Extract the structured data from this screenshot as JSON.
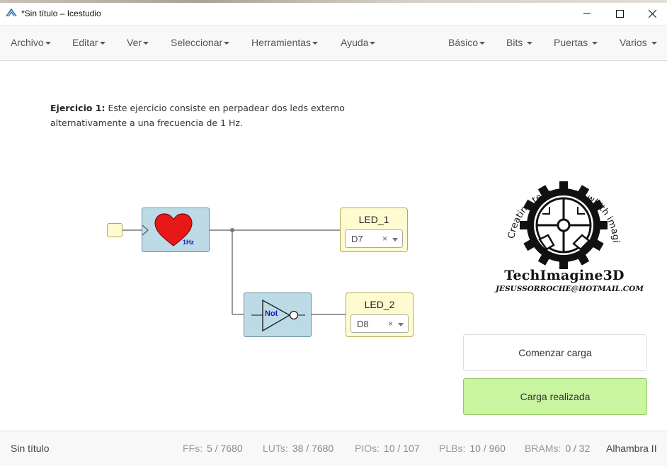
{
  "window": {
    "title": "*Sin título – Icestudio",
    "controls": {
      "minimize": "minimize-icon",
      "maximize": "maximize-icon",
      "close": "close-icon"
    }
  },
  "menubar": {
    "left": [
      {
        "label": "Archivo"
      },
      {
        "label": "Editar"
      },
      {
        "label": "Ver"
      },
      {
        "label": "Seleccionar"
      },
      {
        "label": "Herramientas"
      },
      {
        "label": "Ayuda"
      }
    ],
    "right": [
      {
        "label": "Básico"
      },
      {
        "label": "Bits"
      },
      {
        "label": "Puertas"
      },
      {
        "label": "Varios"
      }
    ]
  },
  "canvas": {
    "info": {
      "bold": "Ejercicio 1:",
      "text": " Este ejercicio consiste en perpadear dos leds externo alternativamente a una frecuencia de 1 Hz."
    },
    "heart_block": {
      "label": "1Hz",
      "icon": "heart-icon"
    },
    "not_block": {
      "label": "Not",
      "icon": "not-gate-icon"
    },
    "leds": [
      {
        "name": "LED_1",
        "pin": "D7",
        "clear": "×"
      },
      {
        "name": "LED_2",
        "pin": "D8",
        "clear": "×"
      }
    ],
    "logo": {
      "arc_text": "Creating technology whith imagination",
      "brand": "TechImagine3D",
      "email": "JESUSSORROCHE@HOTMAIL.COM"
    },
    "buttons": {
      "load": "Comenzar carga",
      "done": "Carga realizada"
    }
  },
  "statusbar": {
    "file_name": "Sin título",
    "resources": [
      {
        "label": "FFs:",
        "value": "5 / 7680"
      },
      {
        "label": "LUTs:",
        "value": "38 / 7680"
      },
      {
        "label": "PIOs:",
        "value": "10 / 107"
      },
      {
        "label": "PLBs:",
        "value": "10 / 960"
      },
      {
        "label": "BRAMs:",
        "value": "0 / 32"
      }
    ],
    "board": "Alhambra II"
  },
  "colors": {
    "block_fill": "#bcdbe6",
    "io_fill": "#fffbd0",
    "done_button": "#c9f5a0",
    "heart": "#e81818"
  }
}
